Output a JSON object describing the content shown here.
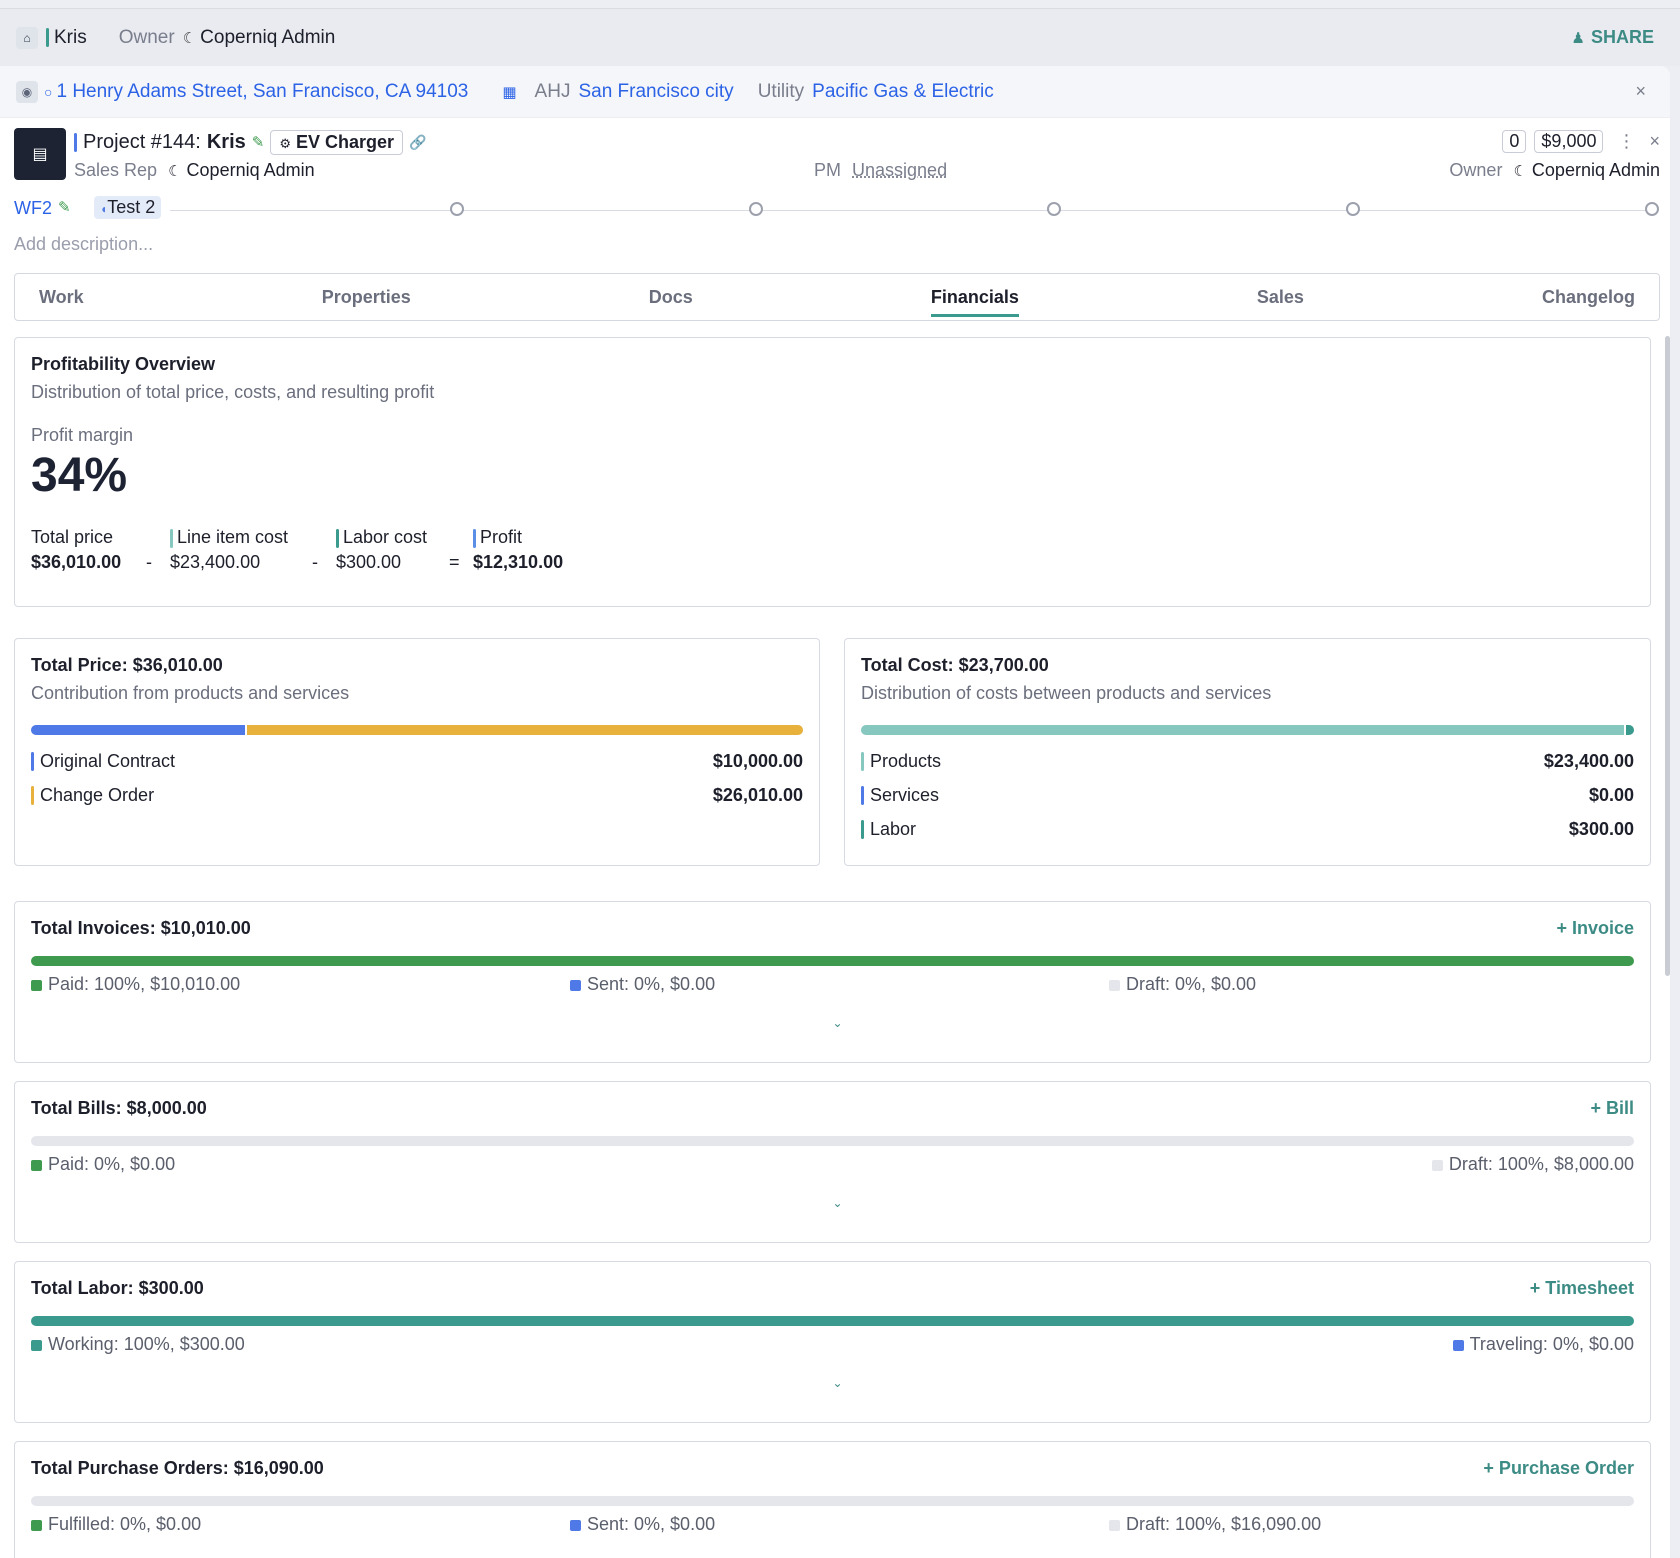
{
  "topbar": {
    "project_name": "Kris",
    "owner_label": "Owner",
    "owner_name": "Coperniq Admin",
    "share_label": "SHARE"
  },
  "address_bar": {
    "address": "1 Henry Adams Street, San Francisco, CA 94103",
    "ahj_label": "AHJ",
    "ahj_value": "San Francisco city",
    "utility_label": "Utility",
    "utility_value": "Pacific Gas & Electric"
  },
  "project": {
    "number_label": "Project #144:",
    "name": "Kris",
    "type_chip": "EV Charger",
    "count": "0",
    "value": "$9,000",
    "sales_rep_label": "Sales Rep",
    "sales_rep_name": "Coperniq Admin",
    "pm_label": "PM",
    "pm_value": "Unassigned",
    "owner_label": "Owner",
    "owner_name": "Coperniq Admin",
    "workflow": "WF2",
    "stage": "Test 2",
    "description_placeholder": "Add description..."
  },
  "tabs": [
    "Work",
    "Properties",
    "Docs",
    "Financials",
    "Sales",
    "Changelog"
  ],
  "active_tab": "Financials",
  "profitability": {
    "title": "Profitability Overview",
    "subtitle": "Distribution of total price, costs, and resulting profit",
    "margin_label": "Profit margin",
    "margin_value": "34%",
    "total_price_label": "Total price",
    "total_price": "$36,010.00",
    "line_item_label": "Line item cost",
    "line_item_cost": "$23,400.00",
    "labor_label": "Labor cost",
    "labor_cost": "$300.00",
    "profit_label": "Profit",
    "profit": "$12,310.00",
    "op_minus": "-",
    "op_equals": "="
  },
  "total_price_card": {
    "title": "Total Price: $36,010.00",
    "subtitle": "Contribution from products and services",
    "rows": [
      {
        "label": "Original Contract",
        "value": "$10,000.00",
        "share": 0.2777,
        "color": "#4e79e6"
      },
      {
        "label": "Change Order",
        "value": "$26,010.00",
        "share": 0.7223,
        "color": "#e8b13c"
      }
    ]
  },
  "total_cost_card": {
    "title": "Total Cost: $23,700.00",
    "subtitle": "Distribution of costs between products and services",
    "rows": [
      {
        "label": "Products",
        "value": "$23,400.00",
        "share": 0.9873,
        "color": "#86c8c0"
      },
      {
        "label": "Services",
        "value": "$0.00",
        "share": 0,
        "color": "#4e79e6"
      },
      {
        "label": "Labor",
        "value": "$300.00",
        "share": 0.0127,
        "color": "#3a9a8e"
      }
    ]
  },
  "invoices": {
    "title": "Total Invoices: $10,010.00",
    "action": "+ Invoice",
    "paid": "Paid: 100%, $10,010.00",
    "sent": "Sent: 0%, $0.00",
    "draft": "Draft: 0%, $0.00",
    "paid_fraction": 1.0
  },
  "bills": {
    "title": "Total Bills: $8,000.00",
    "action": "+ Bill",
    "paid": "Paid: 0%, $0.00",
    "draft": "Draft: 100%, $8,000.00",
    "paid_fraction": 0
  },
  "labor": {
    "title": "Total Labor: $300.00",
    "action": "+ Timesheet",
    "working": "Working: 100%, $300.00",
    "traveling": "Traveling: 0%, $0.00",
    "working_fraction": 1.0
  },
  "purchase_orders": {
    "title": "Total Purchase Orders: $16,090.00",
    "action": "+ Purchase Order",
    "fulfilled": "Fulfilled: 0%, $0.00",
    "sent": "Sent: 0%, $0.00",
    "draft": "Draft: 100%, $16,090.00",
    "fulfilled_fraction": 0
  },
  "colors": {
    "accent": "#3d8b85",
    "link": "#2c63e6",
    "paid_green": "#3e9a4e",
    "labor_teal": "#3a9a8e",
    "blue": "#4e79e6",
    "draft_gray": "#e4e6eb"
  }
}
